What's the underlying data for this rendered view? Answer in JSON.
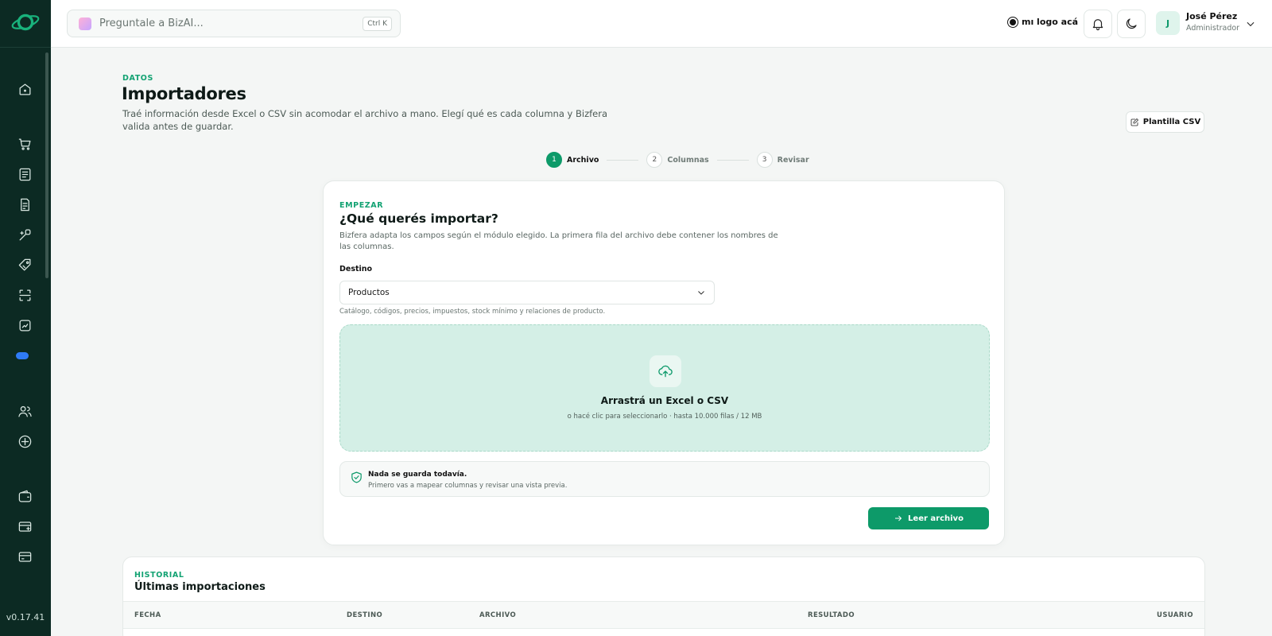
{
  "sidebar": {
    "version": "v0.17.41",
    "icons": [
      "home-icon",
      "cart-icon",
      "list-icon",
      "document-icon",
      "wand-icon",
      "tag-icon",
      "scan-icon",
      "chart-icon",
      "cloud-icon",
      "users-icon",
      "compass-icon",
      "wallet-icon",
      "store-icon",
      "card-icon"
    ]
  },
  "topbar": {
    "search_placeholder": "Preguntale a BizAI...",
    "shortcut": "Ctrl K",
    "brand_text": "mı logo acá",
    "user_initial": "J",
    "user_name": "José Pérez",
    "user_role": "Administrador"
  },
  "page": {
    "eyebrow": "DATOS",
    "title": "Importadores",
    "description": "Traé información desde Excel o CSV sin acomodar el archivo a mano. Elegí qué es cada columna y Bizfera valida antes de guardar.",
    "template_button": "Plantilla CSV"
  },
  "stepper": [
    {
      "num": "1",
      "label": "Archivo",
      "active": true
    },
    {
      "num": "2",
      "label": "Columnas",
      "active": false
    },
    {
      "num": "3",
      "label": "Revisar",
      "active": false
    }
  ],
  "card": {
    "eyebrow": "EMPEZAR",
    "title": "¿Qué querés importar?",
    "description": "Bizfera adapta los campos según el módulo elegido. La primera fila del archivo debe contener los nombres de las columnas.",
    "field_label": "Destino",
    "select_value": "Productos",
    "helper": "Catálogo, códigos, precios, impuestos, stock mínimo y relaciones de producto.",
    "dropzone_title": "Arrastrá un Excel o CSV",
    "dropzone_sub": "o hacé clic para seleccionarlo · hasta 10.000 filas / 12 MB",
    "note_title": "Nada se guarda todavía.",
    "note_sub": "Primero vas a mapear columnas y revisar una vista previa.",
    "primary_button": "Leer archivo"
  },
  "history": {
    "eyebrow": "HISTORIAL",
    "title": "Últimas importaciones",
    "columns": [
      "FECHA",
      "DESTINO",
      "ARCHIVO",
      "RESULTADO",
      "USUARIO"
    ]
  },
  "colors": {
    "sidebar_bg": "#0c2a23",
    "accent": "#0d9a69",
    "dropzone_bg": "#d4efe6",
    "cloud_icon": "#2f7bf5"
  }
}
